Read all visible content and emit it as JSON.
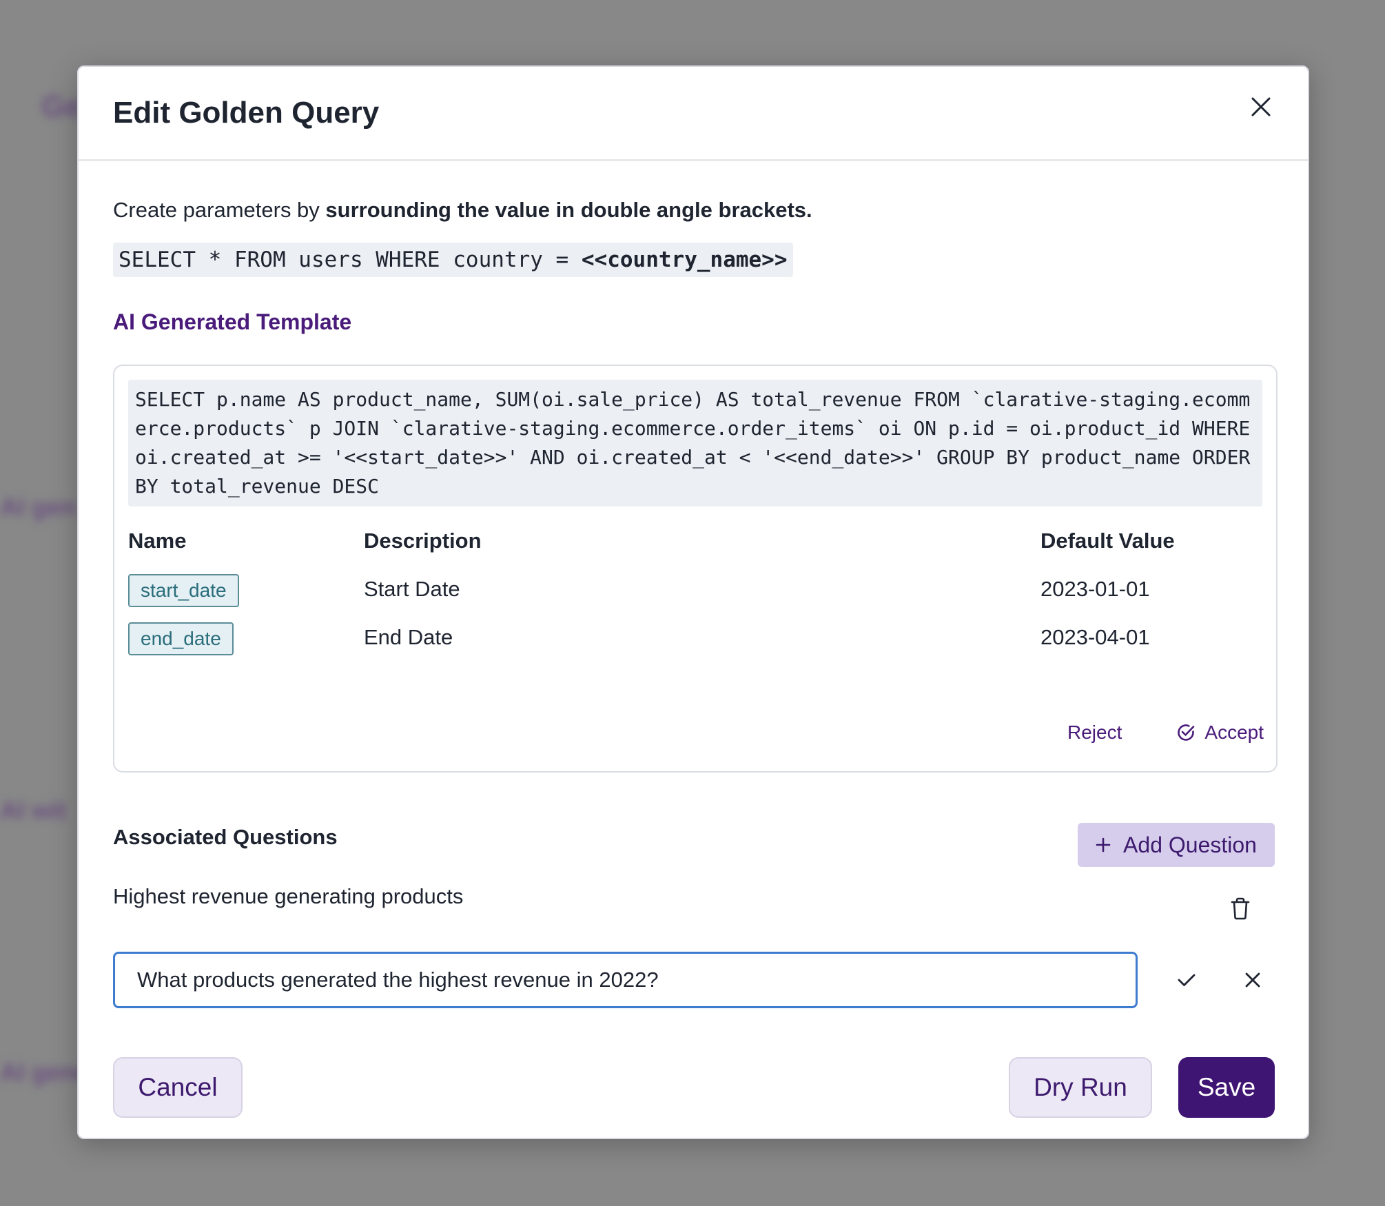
{
  "modal": {
    "title": "Edit Golden Query",
    "intro_prefix": "Create parameters by ",
    "intro_bold": "surrounding the value in double angle brackets.",
    "example_code_prefix": "SELECT * FROM users WHERE country = ",
    "example_code_param": "<<country_name>>"
  },
  "ai_template": {
    "heading": "AI Generated Template",
    "sql": "SELECT p.name AS product_name, SUM(oi.sale_price) AS total_revenue FROM `clarative-staging.ecommerce.products` p JOIN `clarative-staging.ecommerce.order_items` oi ON p.id = oi.product_id WHERE oi.created_at >= '<<start_date>>' AND oi.created_at < '<<end_date>>' GROUP BY product_name ORDER BY total_revenue DESC",
    "columns": {
      "name": "Name",
      "description": "Description",
      "default_value": "Default Value"
    },
    "params": [
      {
        "name": "start_date",
        "description": "Start Date",
        "default_value": "2023-01-01"
      },
      {
        "name": "end_date",
        "description": "End Date",
        "default_value": "2023-04-01"
      }
    ],
    "reject_label": "Reject",
    "accept_label": "Accept"
  },
  "questions": {
    "heading": "Associated Questions",
    "add_label": "Add Question",
    "existing": "Highest revenue generating products",
    "input_value": "What products generated the highest revenue in 2022?"
  },
  "footer": {
    "cancel_label": "Cancel",
    "dry_run_label": "Dry Run",
    "save_label": "Save"
  },
  "background_text": {
    "line1": "Ge",
    "line2": "AI gen",
    "line3": "AI wit",
    "line4": "AI gene"
  },
  "colors": {
    "accent": "#4a1b7a",
    "save_bg": "#3f1573",
    "chip_border": "#5b8d97",
    "input_border": "#3e7ccf"
  }
}
